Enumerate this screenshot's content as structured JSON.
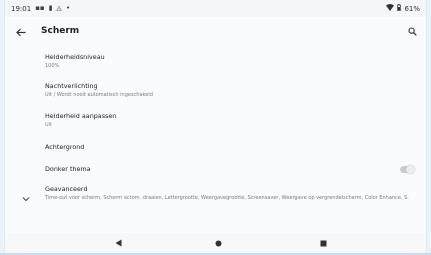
{
  "status_bar": {
    "time": "19:01",
    "battery": "61%"
  },
  "app_bar": {
    "title": "Scherm"
  },
  "settings": {
    "items": [
      {
        "title": "Helderheidsniveau",
        "subtitle": "100%"
      },
      {
        "title": "Nachtverlichting",
        "subtitle": "Uit / Wordt nooit automatisch ingeschakeld"
      },
      {
        "title": "Helderheid aanpassen",
        "subtitle": "Uit"
      },
      {
        "title": "Achtergrond",
        "subtitle": ""
      },
      {
        "title": "Donker thema",
        "subtitle": ""
      },
      {
        "title": "Geavanceerd",
        "subtitle": "Time-out voor scherm, Scherm actom. draaien, Lettergrootte, Weergavegrootte, Screensaver, Weergave op vergrendelscherm, Color Enhance, S."
      }
    ]
  },
  "dark_theme_enabled": false,
  "icons": {
    "back": "back-arrow-icon",
    "search": "search-icon",
    "expand": "chevron-down-icon",
    "wifi": "wifi-icon",
    "battery": "battery-icon"
  },
  "colors": {
    "background": "#fafbfc",
    "text_primary": "#222222",
    "text_secondary": "#7a7a7a"
  }
}
